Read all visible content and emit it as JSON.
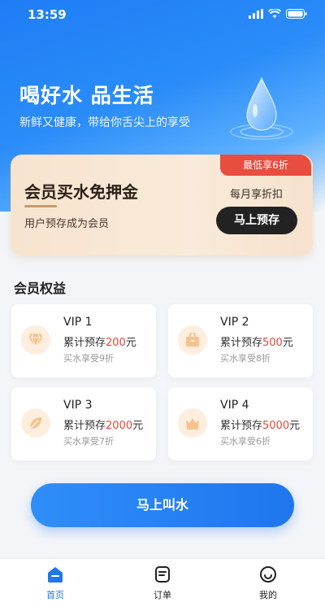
{
  "status_bar": {
    "time": "13:59"
  },
  "hero": {
    "title": "喝好水 品生活",
    "subtitle": "新鲜又健康，带给你舌尖上的享受"
  },
  "member_card": {
    "title": "会员买水免押金",
    "subtitle": "用户预存成为会员",
    "badge": "最低享6折",
    "right_text": "每月享折扣",
    "button": "马上预存"
  },
  "benefits": {
    "title": "会员权益",
    "items": [
      {
        "name": "VIP 1",
        "prefix": "累计预存",
        "amount": "200",
        "suffix": "元",
        "discount": "买水享受9折",
        "icon": "diamond-icon"
      },
      {
        "name": "VIP 2",
        "prefix": "累计预存",
        "amount": "500",
        "suffix": "元",
        "discount": "买水享受8折",
        "icon": "bag-icon"
      },
      {
        "name": "VIP 3",
        "prefix": "累计预存",
        "amount": "2000",
        "suffix": "元",
        "discount": "买水享受7折",
        "icon": "leaf-icon"
      },
      {
        "name": "VIP 4",
        "prefix": "累计预存",
        "amount": "5000",
        "suffix": "元",
        "discount": "买水享受6折",
        "icon": "crown-icon"
      }
    ]
  },
  "call_button": "马上叫水",
  "tabs": [
    {
      "label": "首页",
      "icon": "home-icon",
      "active": true
    },
    {
      "label": "订单",
      "icon": "order-icon",
      "active": false
    },
    {
      "label": "我的",
      "icon": "profile-icon",
      "active": false
    }
  ],
  "colors": {
    "primary": "#1f76ee",
    "accent": "#e8473a",
    "gold": "#c79a6b"
  }
}
